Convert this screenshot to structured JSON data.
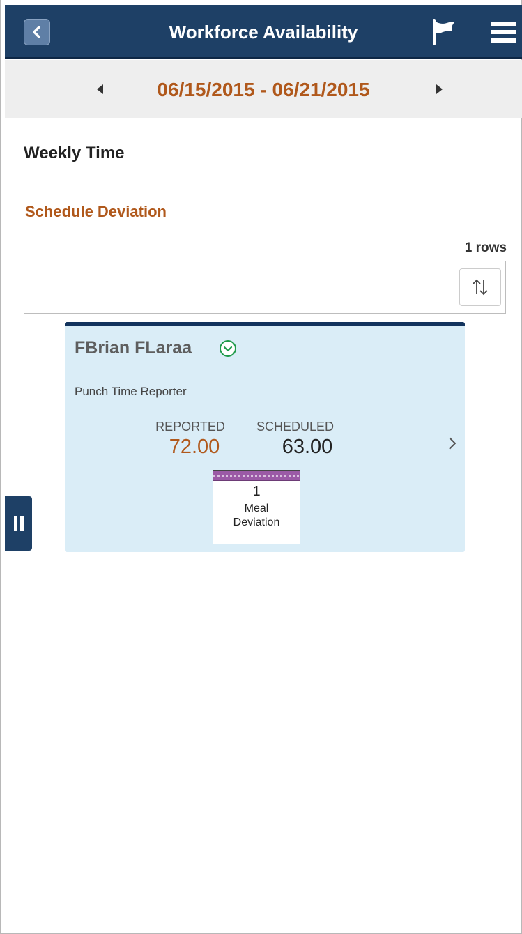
{
  "header": {
    "title": "Workforce Availability",
    "back_icon": "back-icon",
    "flag_icon": "flag-icon",
    "menu_icon": "menu-icon"
  },
  "date_nav": {
    "range": "06/15/2015 - 06/21/2015"
  },
  "page": {
    "title": "Weekly Time",
    "section_title": "Schedule Deviation",
    "rows_count": "1 rows"
  },
  "tile": {
    "employee_name": "FBrian FLaraa",
    "role": "Punch Time Reporter",
    "reported_label": "REPORTED",
    "reported_value": "72.00",
    "scheduled_label": "SCHEDULED",
    "scheduled_value": "63.00",
    "exception": {
      "count": "1",
      "label_line1": "Meal",
      "label_line2": "Deviation"
    }
  },
  "colors": {
    "header_bg": "#1e4066",
    "accent": "#b0581b",
    "tile_bg": "#daedf7"
  }
}
